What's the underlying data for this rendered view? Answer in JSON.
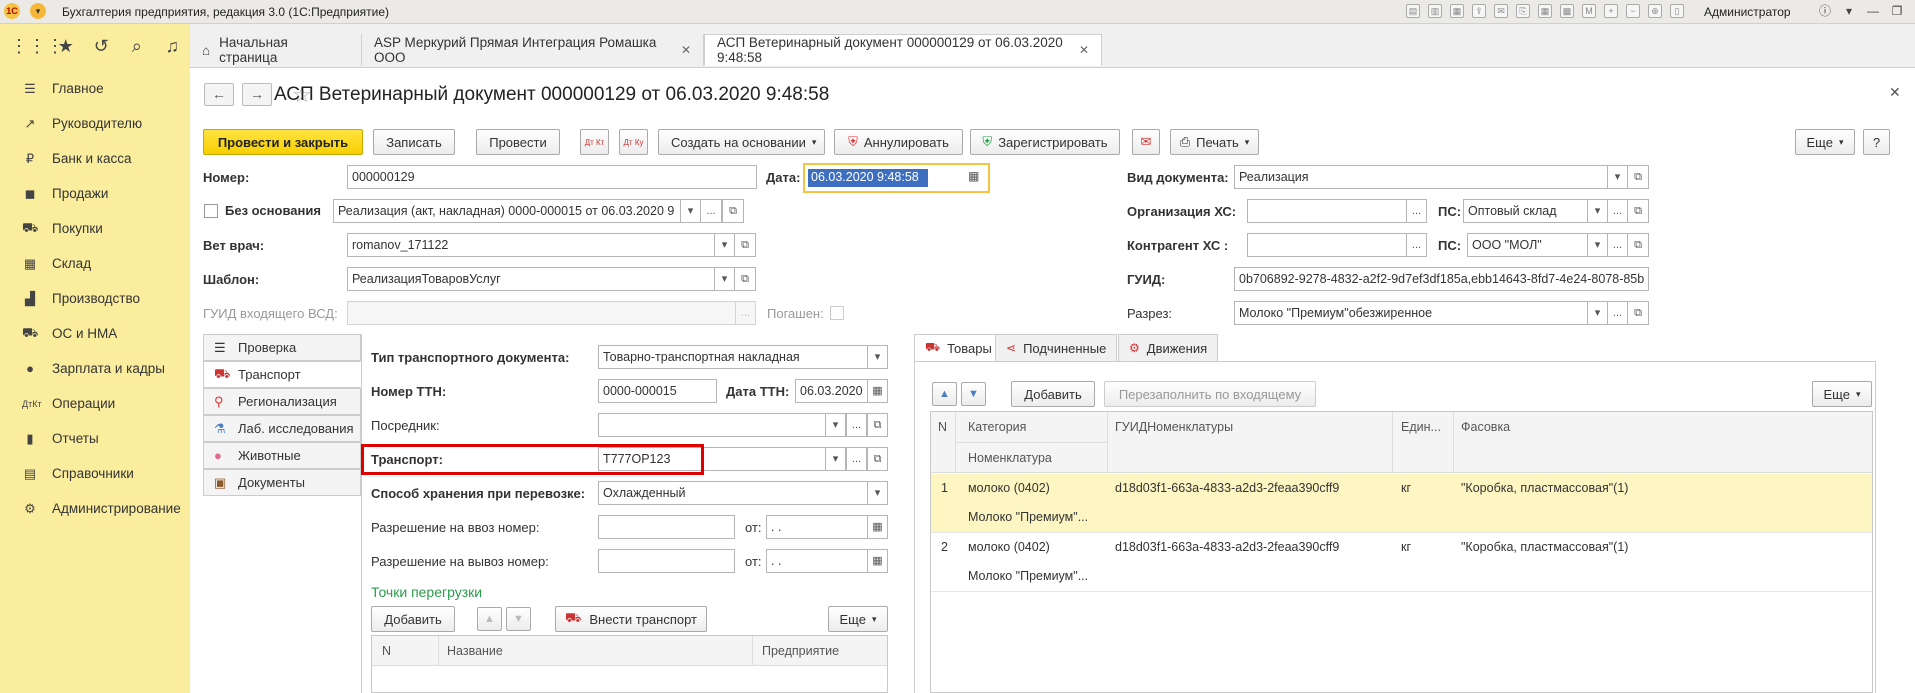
{
  "window": {
    "title": "Бухгалтерия предприятия, редакция 3.0  (1С:Предприятие)",
    "user": "Администратор",
    "logo": "1С"
  },
  "sections": [
    {
      "label": "Главное",
      "icon": "menu-icon"
    },
    {
      "label": "Руководителю",
      "icon": "chart-line-icon"
    },
    {
      "label": "Банк и касса",
      "icon": "ruble-icon"
    },
    {
      "label": "Продажи",
      "icon": "shopping-bag-icon"
    },
    {
      "label": "Покупки",
      "icon": "cart-icon"
    },
    {
      "label": "Склад",
      "icon": "warehouse-icon"
    },
    {
      "label": "Производство",
      "icon": "factory-icon"
    },
    {
      "label": "ОС и НМА",
      "icon": "truck-icon"
    },
    {
      "label": "Зарплата и кадры",
      "icon": "person-icon"
    },
    {
      "label": "Операции",
      "icon": "dt-kt-icon"
    },
    {
      "label": "Отчеты",
      "icon": "bar-chart-icon"
    },
    {
      "label": "Справочники",
      "icon": "book-icon"
    },
    {
      "label": "Администрирование",
      "icon": "gear-icon"
    }
  ],
  "tabs": [
    {
      "label": "Начальная страница"
    },
    {
      "label": "ASP Меркурий Прямая Интеграция Ромашка ООО"
    },
    {
      "label": "АСП Ветеринарный документ 000000129 от 06.03.2020 9:48:58"
    }
  ],
  "document": {
    "title": "АСП Ветеринарный документ 000000129 от 06.03.2020 9:48:58"
  },
  "toolbar": {
    "post_close": "Провести и закрыть",
    "save": "Записать",
    "post": "Провести",
    "dt_kt": "Дт Кт",
    "dt_ku": "Дт Ку",
    "create_based": "Создать на основании",
    "annul": "Аннулировать",
    "register": "Зарегистрировать",
    "print": "Печать",
    "more": "Еще",
    "help": "?"
  },
  "form": {
    "number_label": "Номер:",
    "number": "000000129",
    "date_label": "Дата:",
    "date": "06.03.2020  9:48:58",
    "no_basis_label": "Без основания",
    "basis": "Реализация (акт, накладная) 0000-000015 от 06.03.2020 9",
    "vet_label": "Вет врач:",
    "vet": "romanov_171122",
    "template_label": "Шаблон:",
    "template": "РеализацияТоваровУслуг",
    "guid_in_label": "ГУИД входящего ВСД:",
    "guid_in": "",
    "repaid_label": "Погашен:",
    "doc_type_label": "Вид документа:",
    "doc_type": "Реализация",
    "org_label": "Организация ХС:",
    "org": "",
    "ps_label": "ПС:",
    "ps_org": "Оптовый склад",
    "contractor_label": "Контрагент ХС   :",
    "contractor": "",
    "ps_contractor": "ООО \"МОЛ\"",
    "guid_label": "ГУИД:",
    "guid": "0b706892-9278-4832-a2f2-9d7ef3df185a,ebb14643-8fd7-4e24-8078-85b",
    "section_label": "Разрез:",
    "section": "Молоко \"Премиум\"обезжиренное"
  },
  "sidetabs": [
    {
      "label": "Проверка",
      "icon": "checklist-icon"
    },
    {
      "label": "Транспорт",
      "icon": "truck-icon"
    },
    {
      "label": "Регионализация",
      "icon": "map-pin-icon"
    },
    {
      "label": "Лаб. исследования",
      "icon": "flask-icon"
    },
    {
      "label": "Животные",
      "icon": "pig-icon"
    },
    {
      "label": "Документы",
      "icon": "briefcase-icon"
    }
  ],
  "transport": {
    "doc_type_label": "Тип транспортного документа:",
    "doc_type": "Товарно-транспортная накладная",
    "ttn_number_label": "Номер ТТН:",
    "ttn_number": "0000-000015",
    "ttn_date_label": "Дата ТТН:",
    "ttn_date": "06.03.2020",
    "intermediary_label": "Посредник:",
    "intermediary": "",
    "transport_label": "Транспорт:",
    "transport": "Т777ОР123",
    "storage_label": "Способ хранения при перевозке:",
    "storage": "Охлажденный",
    "import_label": "Разрешение на ввоз номер:",
    "export_label": "Разрешение на вывоз номер:",
    "from_label": "от:",
    "empty_date": " .  .",
    "reload_title": "Точки перегрузки",
    "add": "Добавить",
    "add_transport": "Внести транспорт",
    "more": "Еще",
    "columns": [
      "N",
      "Название",
      "Предприятие"
    ]
  },
  "goods": {
    "tabs": [
      {
        "label": "Товары",
        "icon": "truck-icon"
      },
      {
        "label": "Подчиненные",
        "icon": "share-icon"
      },
      {
        "label": "Движения",
        "icon": "movement-icon"
      }
    ],
    "add": "Добавить",
    "refill": "Перезаполнить по входящему",
    "more": "Еще",
    "columns": {
      "n": "N",
      "category": "Категория",
      "nomenclature": "Номенклатура",
      "guid": "ГУИДНоменклатуры",
      "unit": "Един...",
      "packing": "Фасовка"
    },
    "rows": [
      {
        "n": "1",
        "category": "молоко (0402)",
        "nomenclature": "Молоко \"Премиум\"...",
        "guid": "d18d03f1-663a-4833-a2d3-2feaa390cff9",
        "unit": "кг",
        "packing": "\"Коробка, пластмассовая\"(1)"
      },
      {
        "n": "2",
        "category": "молоко (0402)",
        "nomenclature": "Молоко \"Премиум\"...",
        "guid": "d18d03f1-663a-4833-a2d3-2feaa390cff9",
        "unit": "кг",
        "packing": "\"Коробка, пластмассовая\"(1)"
      }
    ]
  }
}
